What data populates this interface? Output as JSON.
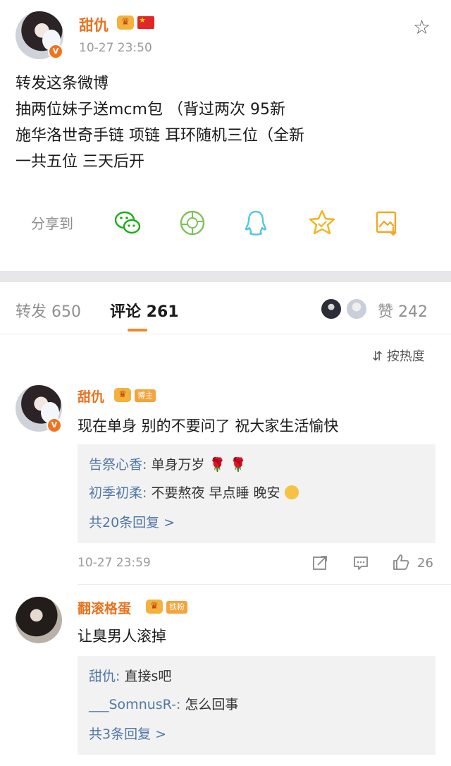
{
  "post": {
    "author": "甜仇",
    "verified_badge": "V",
    "crown_icon": "crown-icon",
    "flag_icon": "china-flag-icon",
    "timestamp": "10-27 23:50",
    "text_lines": [
      "转发这条微博",
      "抽两位妹子送mcm包 （背过两次 95新",
      "施华洛世奇手链 项链 耳环随机三位（全新",
      "一共五位 三天后开"
    ],
    "share_label": "分享到",
    "share_targets": [
      "wechat-icon",
      "moments-icon",
      "qq-icon",
      "favorite-icon",
      "save-image-icon"
    ]
  },
  "tabs": {
    "reposts": "转发 650",
    "comments": "评论 261",
    "likes": "赞 242"
  },
  "sort": {
    "label": "按热度"
  },
  "comments": [
    {
      "author": "甜仇",
      "role": "博主",
      "text": "现在单身 别的不要问了 祝大家生活愉快",
      "replies": [
        {
          "user": "告祭心香",
          "text": "单身万岁"
        },
        {
          "user": "初季初柔",
          "text": "不要熬夜 早点睡 晚安"
        }
      ],
      "more": "共20条回复 >",
      "time": "10-27 23:59",
      "likes": "26"
    },
    {
      "author": "翻滚格蛋",
      "role": "铁粉",
      "text": "让臭男人滚掉",
      "replies": [
        {
          "user": "甜仇",
          "text": "直接s吧"
        },
        {
          "user": "___SomnusR-",
          "text": "怎么回事"
        }
      ],
      "more": "共3条回复 >"
    }
  ],
  "colors": {
    "username": "#e8731e",
    "reply_user": "#5077a8",
    "accent": "#f08a24",
    "share_green": "#1aad19",
    "share_teal": "#54c4ea",
    "share_yellow": "#f5b21b"
  }
}
